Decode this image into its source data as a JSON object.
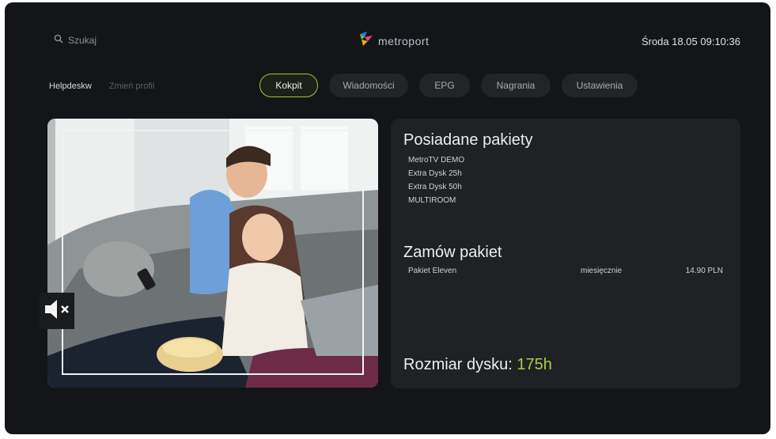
{
  "header": {
    "search_label": "Szukaj",
    "brand": "metroport",
    "datetime": "Środa 18.05 09:10:36"
  },
  "profile_nav": {
    "helpdesk": "Helpdeskw",
    "change_profile": "Zmień profil"
  },
  "menu": {
    "items": [
      {
        "label": "Kokpit",
        "active": true
      },
      {
        "label": "Wiadomości",
        "active": false
      },
      {
        "label": "EPG",
        "active": false
      },
      {
        "label": "Nagrania",
        "active": false
      },
      {
        "label": "Ustawienia",
        "active": false
      }
    ]
  },
  "video": {
    "muted": true,
    "icon": "mute-icon"
  },
  "owned": {
    "title": "Posiadane pakiety",
    "items": [
      "MetroTV DEMO",
      "Extra Dysk 25h",
      "Extra Dysk 50h",
      "MULTIROOM"
    ]
  },
  "order": {
    "title": "Zamów pakiet",
    "items": [
      {
        "name": "Pakiet Eleven",
        "period": "miesięcznie",
        "price": "14.90 PLN"
      }
    ]
  },
  "disk": {
    "label": "Rozmiar dysku:",
    "value": "175h"
  },
  "colors": {
    "accent": "#9acb3c",
    "disk_value": "#a8cf3f",
    "background": "#141518",
    "panel": "#1f2124"
  }
}
